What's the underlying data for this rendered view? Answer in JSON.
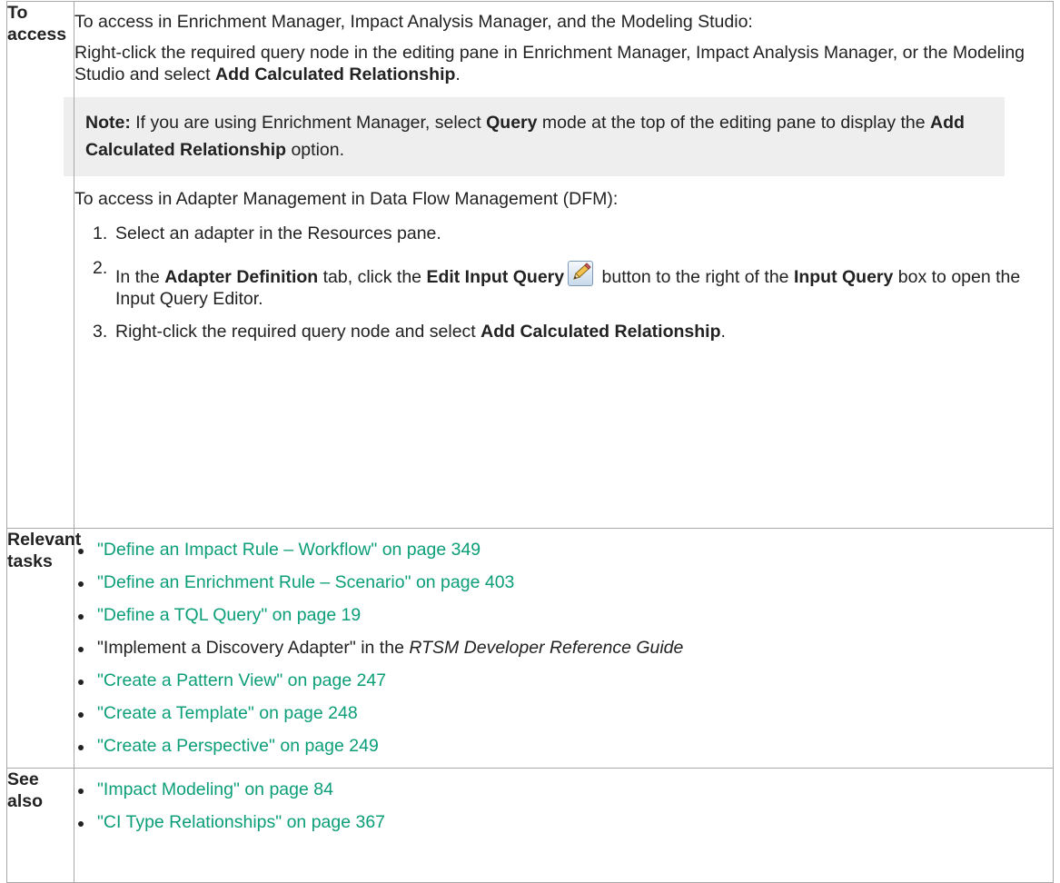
{
  "access": {
    "label": "To access",
    "intro": "To access in Enrichment Manager, Impact Analysis Manager, and the Modeling Studio:",
    "rightclick_text": "Right-click the required query node in the editing pane in Enrichment Manager, Impact Analysis Manager, or the Modeling Studio and select ",
    "rightclick_bold": "Add Calculated Relationship",
    "rightclick_end": ".",
    "note": {
      "label": "Note:",
      "text_a": " If you are using Enrichment Manager, select ",
      "bold_query": "Query",
      "text_b": " mode at the top of the editing pane to display the ",
      "bold_option": "Add Calculated Relationship",
      "text_c": " option."
    },
    "dfm_intro": "To access in Adapter Management in Data Flow Management (DFM):",
    "steps": [
      {
        "num": "1.",
        "text": "Select an adapter in the Resources pane."
      },
      {
        "num": "2.",
        "t1": "In the ",
        "b1": "Adapter Definition",
        "t2": " tab, click the ",
        "b2": "Edit Input Query",
        "t3": " button to the right of the ",
        "b3": "Input Query",
        "t4": " box to open the Input Query Editor.",
        "icon": "pencil-edit-icon"
      },
      {
        "num": "3.",
        "t1": "Right-click the required query node and select ",
        "b1": "Add Calculated Relationship",
        "t2": "."
      }
    ]
  },
  "tasks": {
    "label": "Relevant tasks",
    "items": [
      "\"Define an Impact Rule – Workflow\" on page 349",
      "\"Define an Enrichment Rule – Scenario\" on page 403",
      "\"Define a TQL Query\" on page 19",
      "\"Create a Pattern View\" on page 247",
      "\"Create a Template\" on page 248",
      "\"Create a Perspective\" on page 249"
    ],
    "plain_item": {
      "pre": "\"Implement a Discovery Adapter\" in the ",
      "italic": "RTSM Developer Reference Guide"
    }
  },
  "see_also": {
    "label": "See also",
    "items": [
      "\"Impact Modeling\" on page 84",
      "\"CI Type Relationships\" on page 367"
    ]
  },
  "colors": {
    "link": "#0b9e78",
    "note_bg": "#eeeeee",
    "border": "#a8a8a8"
  }
}
